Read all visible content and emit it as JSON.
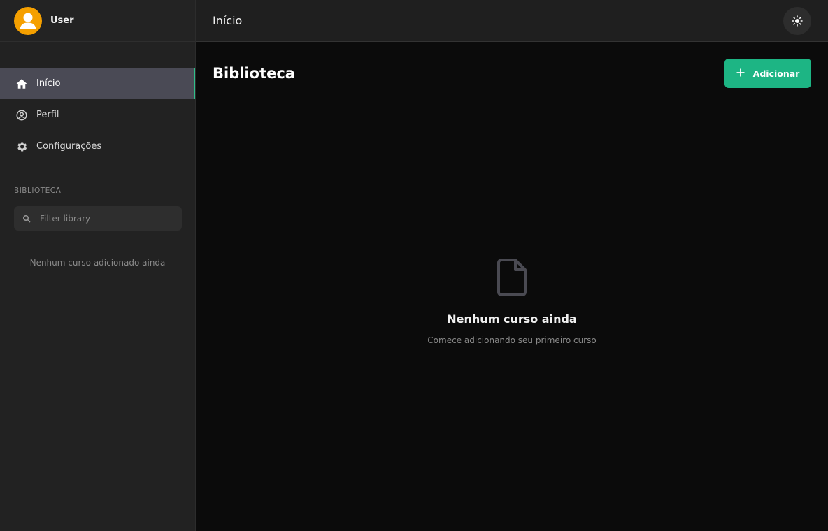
{
  "user": {
    "name": "User",
    "avatar_color": "#f5a000"
  },
  "sidebar": {
    "items": [
      {
        "label": "Início",
        "icon": "home-icon",
        "active": true
      },
      {
        "label": "Perfil",
        "icon": "user-circle-icon",
        "active": false
      },
      {
        "label": "Configurações",
        "icon": "gear-icon",
        "active": false
      }
    ],
    "section_label": "BIBLIOTECA",
    "filter": {
      "placeholder": "Filter library",
      "value": ""
    },
    "empty_text": "Nenhum curso adicionado ainda"
  },
  "topbar": {
    "title": "Início",
    "theme_icon": "sun-icon"
  },
  "main": {
    "title": "Biblioteca",
    "add_button": {
      "label": "Adicionar",
      "icon": "plus-icon"
    },
    "empty_state": {
      "icon": "document-icon",
      "title": "Nenhum curso ainda",
      "subtitle": "Comece adicionando seu primeiro curso"
    }
  },
  "colors": {
    "accent": "#1db584",
    "active_indicator": "#2fbf8a",
    "active_bg": "#4a4a55",
    "sidebar_bg": "#222222",
    "main_bg": "#0b0b0b"
  }
}
